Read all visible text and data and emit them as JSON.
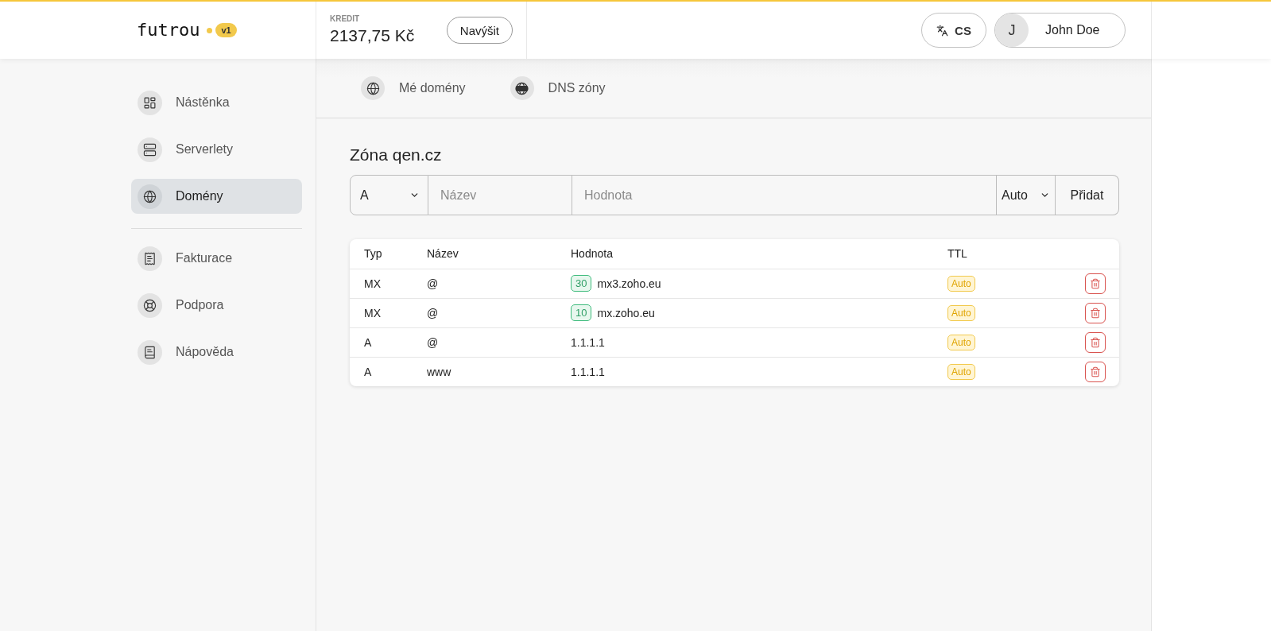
{
  "header": {
    "logo": "futrou",
    "version": "v1",
    "credit_label": "KREDIT",
    "credit_amount": "2137,75 Kč",
    "topup_button": "Navýšit",
    "language": "CS",
    "user": {
      "initial": "J",
      "name": "John Doe"
    }
  },
  "sidebar": {
    "groups": [
      {
        "items": [
          {
            "label": "Nástěnka",
            "selected": false
          },
          {
            "label": "Serverlety",
            "selected": false
          },
          {
            "label": "Domény",
            "selected": true
          }
        ]
      },
      {
        "items": [
          {
            "label": "Fakturace",
            "selected": false
          },
          {
            "label": "Podpora",
            "selected": false
          },
          {
            "label": "Nápověda",
            "selected": false
          }
        ]
      }
    ]
  },
  "tabs": [
    {
      "label": "Mé domény"
    },
    {
      "label": "DNS zóny"
    }
  ],
  "zone": {
    "title": "Zóna qen.cz",
    "form": {
      "type": "A",
      "name_placeholder": "Název",
      "value_placeholder": "Hodnota",
      "ttl": "Auto",
      "submit": "Přidat"
    },
    "table": {
      "columns": [
        "Typ",
        "Název",
        "Hodnota",
        "TTL"
      ],
      "rows": [
        {
          "type": "MX",
          "name": "@",
          "priority": "30",
          "value": "mx3.zoho.eu",
          "ttl": "Auto"
        },
        {
          "type": "MX",
          "name": "@",
          "priority": "10",
          "value": "mx.zoho.eu",
          "ttl": "Auto"
        },
        {
          "type": "A",
          "name": "@",
          "value": "1.1.1.1",
          "ttl": "Auto"
        },
        {
          "type": "A",
          "name": "www",
          "value": "1.1.1.1",
          "ttl": "Auto"
        }
      ]
    }
  }
}
